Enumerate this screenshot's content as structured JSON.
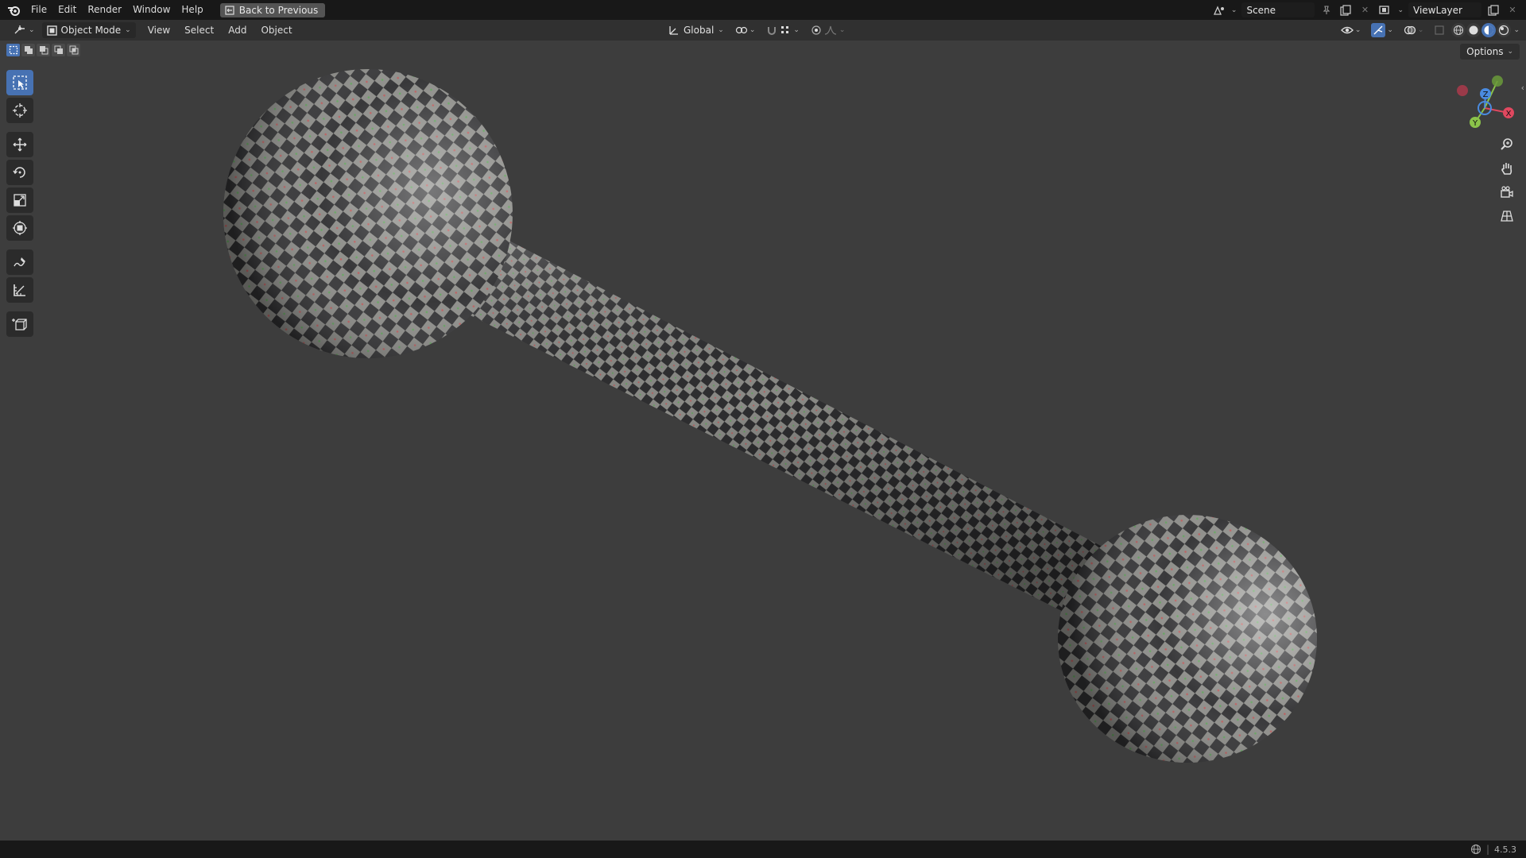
{
  "top_menu": {
    "items": [
      "File",
      "Edit",
      "Render",
      "Window",
      "Help"
    ],
    "back_button": "Back to Previous"
  },
  "scene": {
    "name": "Scene"
  },
  "view_layer": {
    "name": "ViewLayer"
  },
  "header": {
    "mode": "Object Mode",
    "menus": [
      "View",
      "Select",
      "Add",
      "Object"
    ],
    "transform_orientation": "Global"
  },
  "viewport": {
    "options_label": "Options",
    "gizmo_axes": [
      "Z",
      "X",
      "Y"
    ],
    "axis_colors": {
      "x": "#e0485f",
      "y": "#8bc34a",
      "z": "#4a8be0"
    },
    "object": "checker-textured dumbbell"
  },
  "status": {
    "version": "4.5.3"
  },
  "colors": {
    "accent": "#4772b3",
    "viewport_bg": "#3d3d3d"
  }
}
